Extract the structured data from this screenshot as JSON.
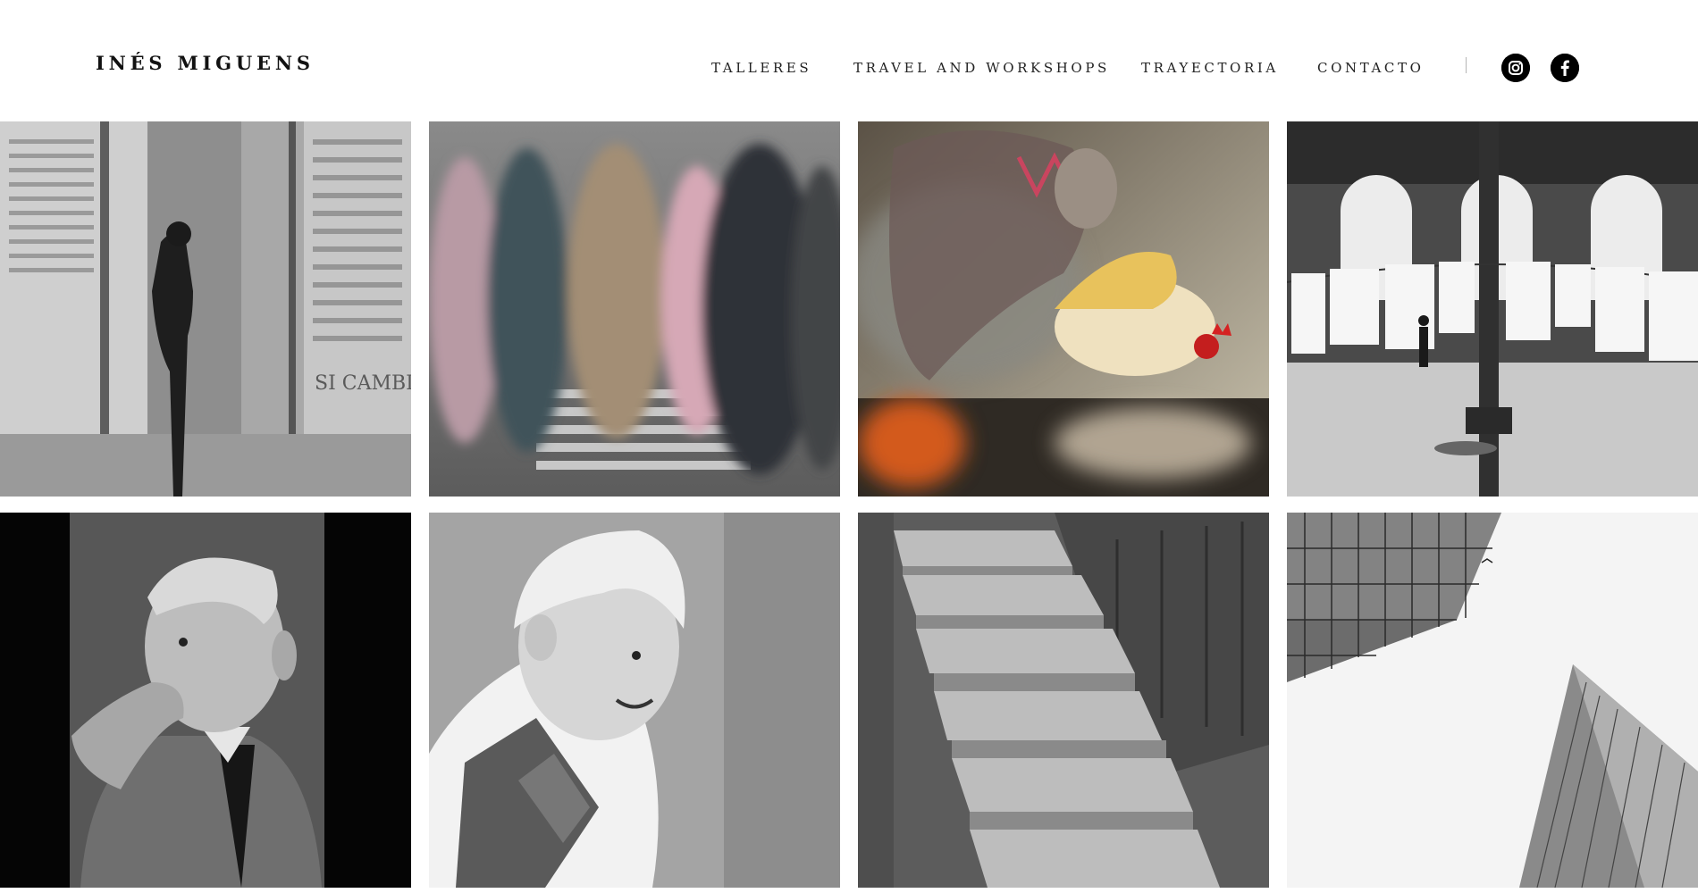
{
  "site": {
    "title": "INÉS MIGUENS"
  },
  "nav": {
    "items": [
      {
        "label": "TALLERES"
      },
      {
        "label": "TRAVEL AND WORKSHOPS"
      },
      {
        "label": "TRAYECTORIA"
      },
      {
        "label": "CONTACTO"
      }
    ]
  },
  "social": {
    "icons": [
      "instagram-icon",
      "facebook-icon"
    ]
  },
  "gallery": {
    "photos": [
      {
        "subject": "woman walking past stone columns with text",
        "watermark_text": "SI CAMBIA"
      },
      {
        "subject": "blurred pedestrians crossing street"
      },
      {
        "subject": "woman holding rooster over smoke"
      },
      {
        "subject": "laundry hanging in arched hall"
      },
      {
        "subject": "elderly man portrait"
      },
      {
        "subject": "smiling toddler in overalls"
      },
      {
        "subject": "stone steps"
      },
      {
        "subject": "skyscrapers in fog"
      }
    ]
  }
}
